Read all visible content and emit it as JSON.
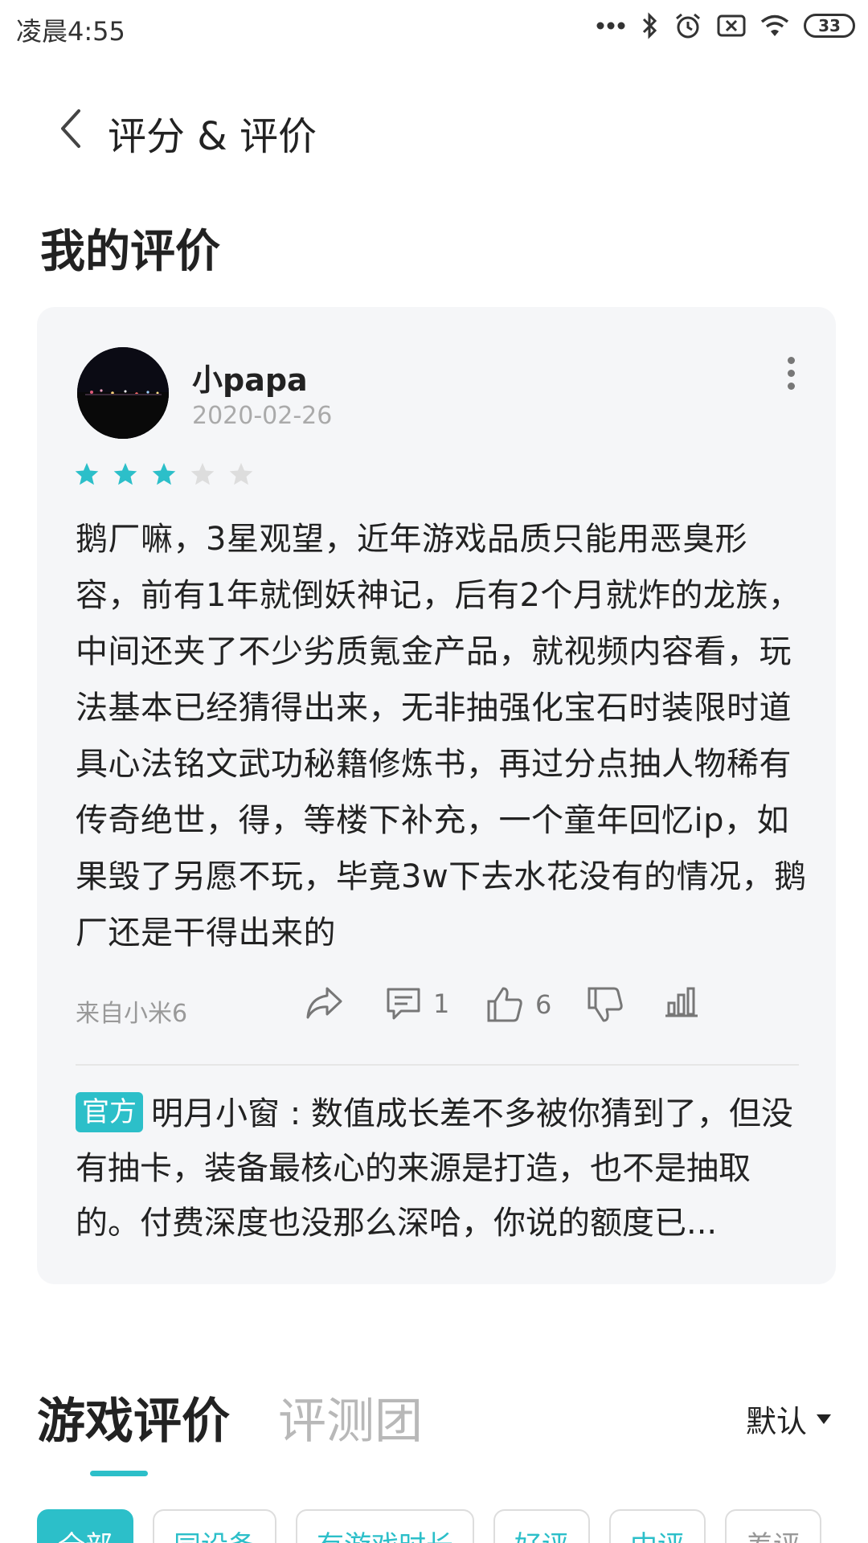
{
  "status_bar": {
    "time": "凌晨4:55",
    "battery": "33",
    "icons": [
      "more-dots-icon",
      "bluetooth-icon",
      "alarm-icon",
      "sim-off-icon",
      "wifi-icon",
      "battery-icon"
    ]
  },
  "header": {
    "back_icon": "back-arrow-icon",
    "title": "评分 & 评价"
  },
  "my_review": {
    "section_title": "我的评价",
    "username": "小papa",
    "date": "2020-02-26",
    "rating": 3,
    "rating_max": 5,
    "text": "鹅厂嘛，3星观望，近年游戏品质只能用恶臭形容，前有1年就倒妖神记，后有2个月就炸的龙族，中间还夹了不少劣质氪金产品，就视频内容看，玩法基本已经猜得出来，无非抽强化宝石时装限时道具心法铭文武功秘籍修炼书，再过分点抽人物稀有传奇绝世，得，等楼下补充，一个童年回忆ip，如果毁了另愿不玩，毕竟3w下去水花没有的情况，鹅厂还是干得出来的",
    "device": "来自小米6",
    "comment_count": "1",
    "like_count": "6",
    "reply": {
      "badge": "官方",
      "text": "明月小窗 : 数值成长差不多被你猜到了，但没有抽卡，装备最核心的来源是打造，也不是抽取的。付费深度也没那么深哈，你说的额度已..."
    }
  },
  "tabs": {
    "game_reviews": "游戏评价",
    "review_team": "评测团",
    "sort_label": "默认"
  },
  "filters": [
    "全部",
    "同设备",
    "有游戏时长",
    "好评",
    "中评",
    "差评"
  ],
  "colors": {
    "accent": "#2cbfc9",
    "star_empty": "#dddddd",
    "card_bg": "#f5f6f8"
  }
}
